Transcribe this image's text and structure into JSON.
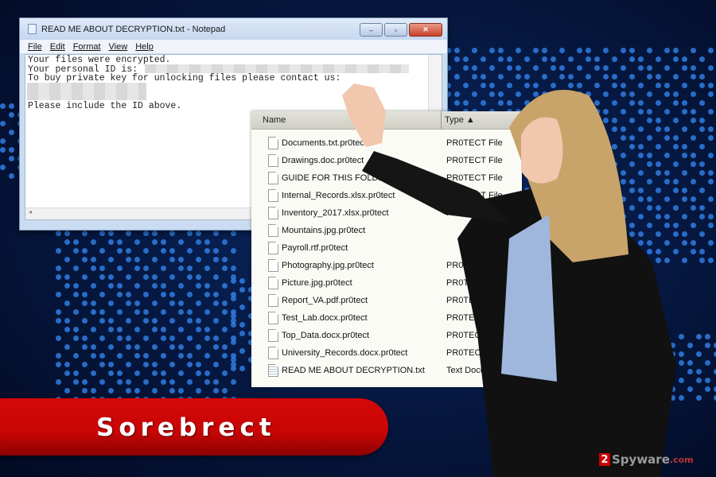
{
  "notepad": {
    "title": "READ ME ABOUT DECRYPTION.txt - Notepad",
    "menu": [
      "File",
      "Edit",
      "Format",
      "View",
      "Help"
    ],
    "lines": [
      "Your files were encrypted.",
      "Your personal ID is:",
      "To buy private key for unlocking files please contact us:",
      "",
      "Please include the ID above."
    ],
    "window_buttons": {
      "minimize": "–",
      "maximize": "▫",
      "close": "✕"
    }
  },
  "explorer": {
    "columns": {
      "name": "Name",
      "type": "Type ▲"
    },
    "files": [
      {
        "name": "Documents.txt.pr0tect",
        "type": "PR0TECT File",
        "icon": "file-icon"
      },
      {
        "name": "Drawings.doc.pr0tect",
        "type": "PR0TECT File",
        "icon": "file-icon"
      },
      {
        "name": "GUIDE FOR THIS FOLDER.pr0tect",
        "type": "PR0TECT File",
        "icon": "file-icon"
      },
      {
        "name": "Internal_Records.xlsx.pr0tect",
        "type": "PR0TECT File",
        "icon": "file-icon"
      },
      {
        "name": "Inventory_2017.xlsx.pr0tect",
        "type": "PR0TECT File",
        "icon": "file-icon"
      },
      {
        "name": "Mountains.jpg.pr0tect",
        "type": "",
        "icon": "file-icon"
      },
      {
        "name": "Payroll.rtf.pr0tect",
        "type": "",
        "icon": "file-icon"
      },
      {
        "name": "Photography.jpg.pr0tect",
        "type": "PR0TECT File",
        "icon": "file-icon"
      },
      {
        "name": "Picture.jpg.pr0tect",
        "type": "PR0TECT File",
        "icon": "file-icon"
      },
      {
        "name": "Report_VA.pdf.pr0tect",
        "type": "PR0TECT File",
        "icon": "file-icon"
      },
      {
        "name": "Test_Lab.docx.pr0tect",
        "type": "PR0TECT File",
        "icon": "file-icon"
      },
      {
        "name": "Top_Data.docx.pr0tect",
        "type": "PR0TECT File",
        "icon": "file-icon"
      },
      {
        "name": "University_Records.docx.pr0tect",
        "type": "PR0TECT File",
        "icon": "file-icon"
      },
      {
        "name": "READ ME ABOUT DECRYPTION.txt",
        "type": "Text Document",
        "icon": "text-file-icon"
      }
    ]
  },
  "banner": {
    "title": "Sorebrect"
  },
  "watermark": {
    "badge": "2",
    "name": "Spyware",
    "tld": ".com"
  },
  "colors": {
    "banner_red": "#c80505",
    "background_navy": "#061a45",
    "dot_blue": "#2f7de0"
  }
}
